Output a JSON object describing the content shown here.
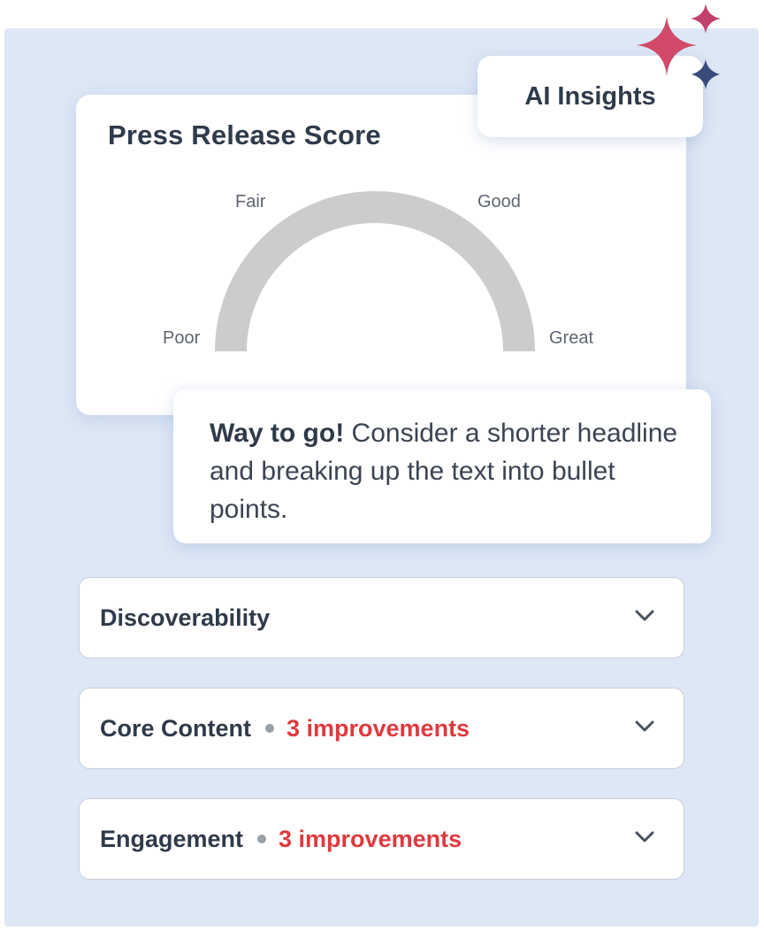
{
  "insights_badge": {
    "label": "AI Insights"
  },
  "score_card": {
    "title": "Press Release Score",
    "gauge": {
      "labels": {
        "poor": "Poor",
        "fair": "Fair",
        "good": "Good",
        "great": "Great"
      },
      "track_color": "#cccccc"
    }
  },
  "message": {
    "bold_text": "Way to go!",
    "text": " Consider a shorter headline and breaking up the text into bullet points."
  },
  "sections": [
    {
      "title": "Discoverability",
      "improvements": "",
      "icon": "chevron-down-icon"
    },
    {
      "title": "Core Content",
      "improvements": "3 improvements",
      "icon": "chevron-down-icon"
    },
    {
      "title": "Engagement",
      "improvements": "3 improvements",
      "icon": "chevron-down-icon"
    }
  ],
  "colors": {
    "panel_background": "#dde7f5",
    "improvement_accent": "#dd3a3f",
    "sparkle_pink": "#d14a6a",
    "sparkle_navy": "#3a4a7a"
  }
}
